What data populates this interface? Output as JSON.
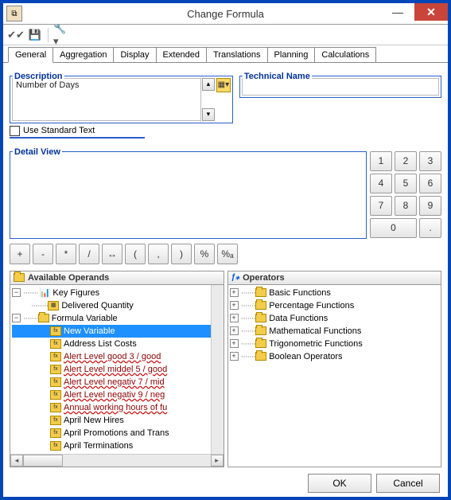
{
  "window": {
    "title": "Change Formula"
  },
  "toolbar": {
    "icons": [
      "check-icon",
      "save-icon",
      "wrench-icon"
    ]
  },
  "tabs": [
    "General",
    "Aggregation",
    "Display",
    "Extended",
    "Translations",
    "Planning",
    "Calculations"
  ],
  "active_tab": 0,
  "groups": {
    "description_label": "Description",
    "description_value": "Number of Days",
    "technical_label": "Technical Name",
    "technical_value": "",
    "use_standard_text": "Use Standard Text",
    "detail_view_label": "Detail View"
  },
  "keypad": [
    "1",
    "2",
    "3",
    "4",
    "5",
    "6",
    "7",
    "8",
    "9",
    "0",
    "."
  ],
  "op_row": [
    "+",
    "-",
    "*",
    "/",
    "↔",
    "(",
    ",",
    ")",
    "%",
    "%ₐ"
  ],
  "operands_panel": {
    "title": "Available Operands"
  },
  "operators_panel": {
    "title": "Operators"
  },
  "operands_tree": {
    "key_figures": "Key Figures",
    "delivered_qty": "Delivered Quantity",
    "formula_variable": "Formula Variable",
    "items": [
      "New Variable",
      "Address List Costs",
      "Alert Level good 3 / good",
      "Alert Level middel 5 / good",
      "Alert Level negativ 7 / mid",
      "Alert Level negativ 9 / neg",
      "Annual working hours of fu",
      "April New Hires",
      "April Promotions and Trans",
      "April Terminations"
    ]
  },
  "operators_tree": [
    "Basic Functions",
    "Percentage Functions",
    "Data Functions",
    "Mathematical Functions",
    "Trigonometric Functions",
    "Boolean Operators"
  ],
  "buttons": {
    "ok": "OK",
    "cancel": "Cancel"
  }
}
